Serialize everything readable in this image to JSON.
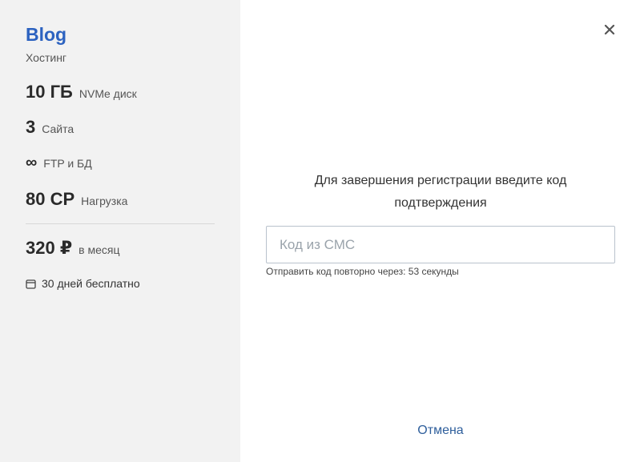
{
  "plan": {
    "name": "Blog",
    "type": "Хостинг",
    "features": [
      {
        "value": "10 ГБ",
        "label": "NVMe диск"
      },
      {
        "value": "3",
        "label": "Сайта"
      },
      {
        "value": "∞",
        "label": "FTP и БД"
      },
      {
        "value": "80 CP",
        "label": "Нагрузка"
      }
    ],
    "price": {
      "amount": "320 ₽",
      "period": "в месяц"
    },
    "trial": {
      "icon": "calendar-icon",
      "text": "30 дней бесплатно"
    }
  },
  "modal": {
    "close_icon": "close-icon",
    "heading": "Для завершения регистрации введите код подтверждения",
    "code_input": {
      "placeholder": "Код из СМС",
      "value": ""
    },
    "resend_label": "Отправить код повторно через:",
    "resend_timer": "53 секунды",
    "cancel_label": "Отмена"
  },
  "colors": {
    "accent": "#2c62c0",
    "link": "#2f5f9c",
    "sidebar_bg": "#f2f2f2"
  }
}
